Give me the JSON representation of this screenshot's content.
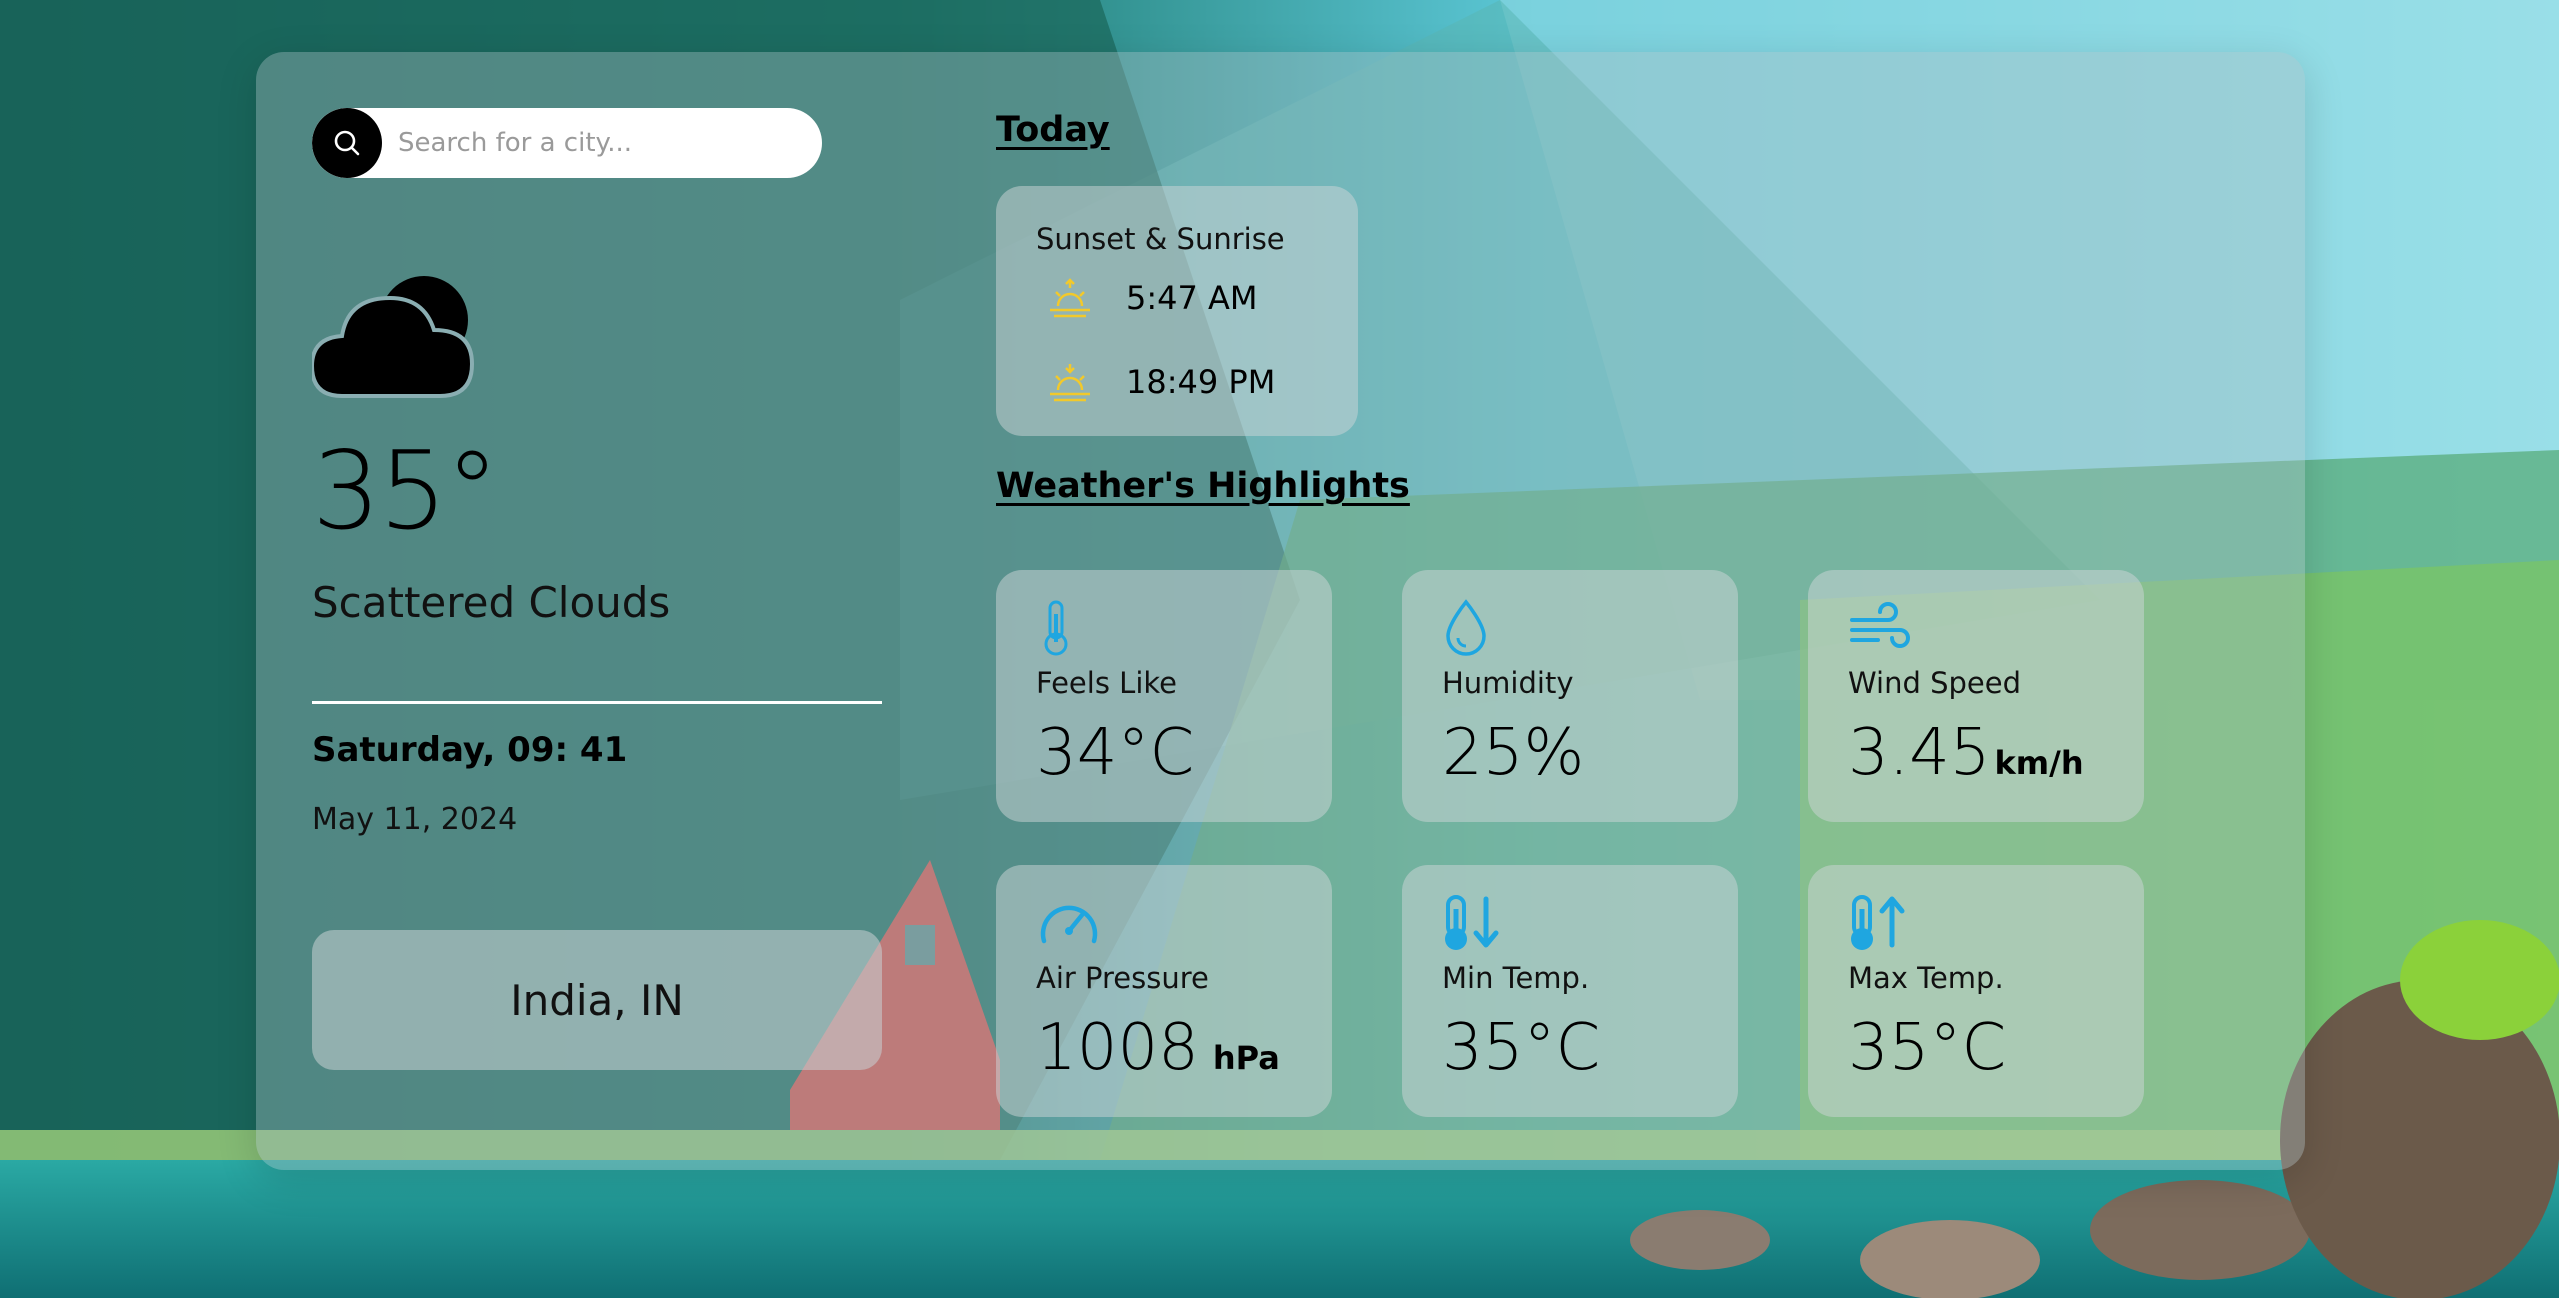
{
  "search": {
    "placeholder": "Search for a city..."
  },
  "current": {
    "temperature": "35°",
    "condition": "Scattered Clouds",
    "day_time": "Saturday, 09: 41",
    "date": "May 11, 2024",
    "location": "India, IN"
  },
  "today": {
    "title": "Today",
    "sun_card_title": "Sunset & Sunrise",
    "sunrise": "5:47 AM",
    "sunset": "18:49 PM"
  },
  "highlights": {
    "title": "Weather's Highlights",
    "feels_like": {
      "label": "Feels Like",
      "value": "34°C",
      "icon": "thermometer-icon"
    },
    "humidity": {
      "label": "Humidity",
      "value": "25%",
      "icon": "water-drop-icon"
    },
    "wind_speed": {
      "label": "Wind Speed",
      "value": "3.45",
      "unit": "km/h",
      "icon": "wind-icon"
    },
    "air_pressure": {
      "label": "Air Pressure",
      "value": "1008",
      "unit": "hPa",
      "icon": "gauge-icon"
    },
    "min_temp": {
      "label": "Min Temp.",
      "value": "35°C",
      "icon": "thermometer-down-icon"
    },
    "max_temp": {
      "label": "Max Temp.",
      "value": "35°C",
      "icon": "thermometer-up-icon"
    }
  },
  "colors": {
    "accent_icon": "#1fa6e0",
    "sun_icon": "#f2c92b"
  }
}
